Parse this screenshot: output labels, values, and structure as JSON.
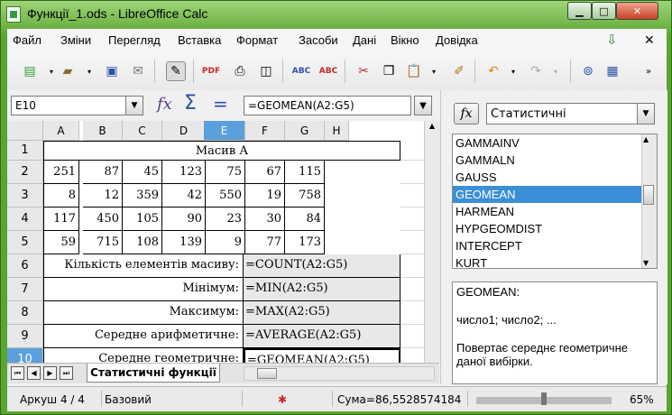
{
  "window": {
    "title": "Функції_1.ods - LibreOffice Calc",
    "minimize_glyph": "▁",
    "maximize_glyph": "□",
    "close_glyph": "✕"
  },
  "menu": [
    "Файл",
    "Зміни",
    "Перегляд",
    "Вставка",
    "Формат",
    "Засоби",
    "Дані",
    "Вікно",
    "Довідка"
  ],
  "toolbar_icons": [
    "new-document-icon",
    "open-icon",
    "save-icon",
    "email-icon",
    "edit-mode-icon",
    "export-pdf-icon",
    "print-icon",
    "print-preview-icon",
    "spellcheck-icon",
    "autospellcheck-icon",
    "cut-icon",
    "copy-icon",
    "paste-icon",
    "clone-formatting-icon",
    "undo-icon",
    "redo-icon",
    "navigator-icon",
    "gallery-icon"
  ],
  "formula_bar": {
    "name_box": "E10",
    "fx_glyph": "fx",
    "sum_glyph": "Σ",
    "equals_glyph": "=",
    "formula": "=GEOMEAN(A2:G5)"
  },
  "sheet": {
    "columns": [
      "A",
      "B",
      "C",
      "D",
      "E",
      "F",
      "G",
      "H"
    ],
    "selected_column": "E",
    "rows": [
      "1",
      "2",
      "3",
      "4",
      "5",
      "6",
      "7",
      "8",
      "9",
      "10"
    ],
    "selected_row": "10",
    "title": "Масив А",
    "data": [
      [
        "251",
        "87",
        "45",
        "123",
        "75",
        "67",
        "115"
      ],
      [
        "8",
        "12",
        "359",
        "42",
        "550",
        "19",
        "758"
      ],
      [
        "117",
        "450",
        "105",
        "90",
        "23",
        "30",
        "84"
      ],
      [
        "59",
        "715",
        "108",
        "139",
        "9",
        "77",
        "173"
      ]
    ],
    "labels": [
      "Кількість елементів масиву:",
      "Мінімум:",
      "Максимум:",
      "Середне арифметичне:",
      "Середне геометричне:"
    ],
    "formulas": [
      "=COUNT(A2:G5)",
      "=MIN(A2:G5)",
      "=MAX(A2:G5)",
      "=AVERAGE(A2:G5)",
      "=GEOMEAN(A2:G5)"
    ]
  },
  "tabs": {
    "active": "Статистичні функції"
  },
  "status": {
    "sheet": "Аркуш 4 / 4",
    "style": "Базовий",
    "sum": "Сума=86,5528574184",
    "zoom": "65%"
  },
  "function_wizard": {
    "category": "Статистичні",
    "functions": [
      "GAMMAINV",
      "GAMMALN",
      "GAUSS",
      "GEOMEAN",
      "HARMEAN",
      "HYPGEOMDIST",
      "INTERCEPT",
      "KURT"
    ],
    "selected": "GEOMEAN",
    "description_name": "GEOMEAN:",
    "description_args": "число1; число2; ...",
    "description_text": "Повертає середнє геометричне даної вибірки."
  },
  "colors": {
    "window_frame": "#5aa52f",
    "selection": "#5ba0dc",
    "list_selection": "#3c8fd6"
  }
}
